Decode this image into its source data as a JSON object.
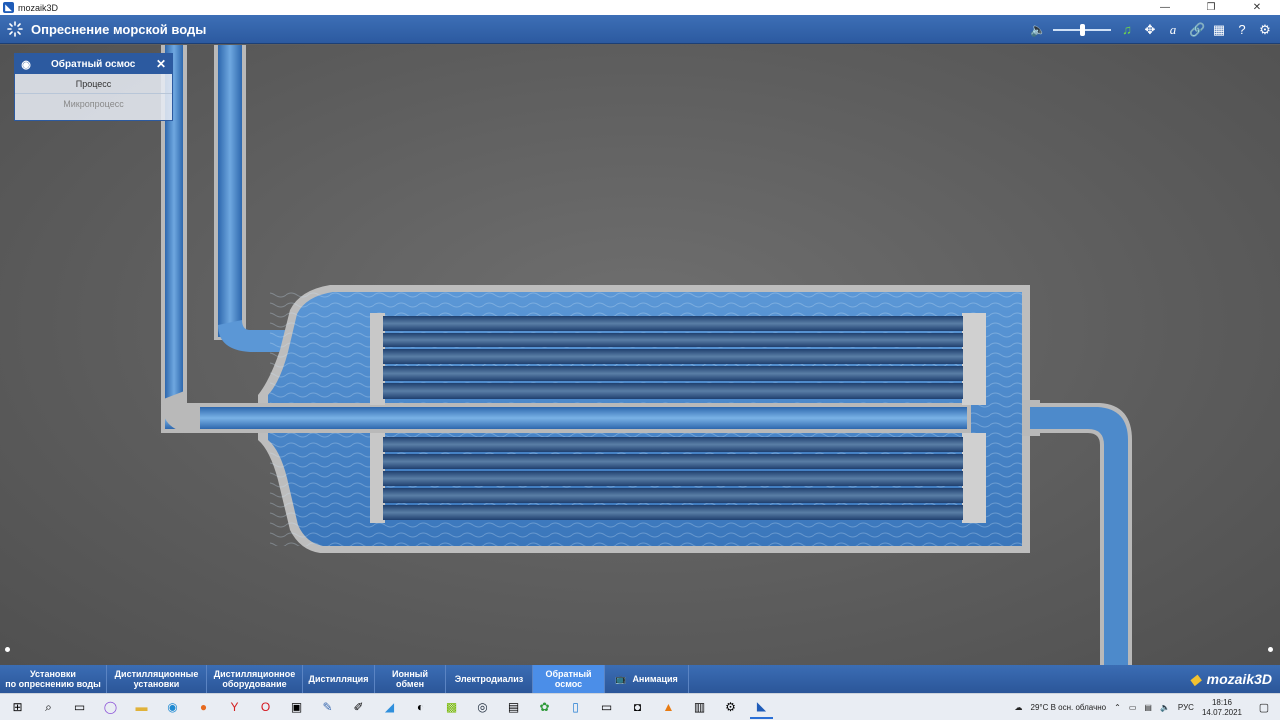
{
  "window": {
    "title": "mozaik3D",
    "controls": [
      "—",
      "❐",
      "✕"
    ]
  },
  "header": {
    "title": "Опреснение морской воды",
    "volume_level": 0.5,
    "tools": [
      "speaker-icon",
      "music-icon",
      "move-icon",
      "font-icon",
      "link-icon",
      "grid-icon",
      "help-icon",
      "gear-icon"
    ]
  },
  "panel": {
    "title": "Обратный осмос",
    "items": [
      "Процесс",
      "Микропроцесс"
    ]
  },
  "nav": {
    "tabs": [
      "Установки\nпо опреснению воды",
      "Дистилляционные\nустановки",
      "Дистилляционное\nоборудование",
      "Дистилляция",
      "Ионный\nобмен",
      "Электродиализ",
      "Обратный\nосмос",
      "Анимация"
    ],
    "active_index": 6,
    "brand": "mozaik3D"
  },
  "taskbar": {
    "weather": "29°C  В осн. облачно",
    "lang": "РУС",
    "time": "18:16",
    "date": "14.07.2021"
  },
  "colors": {
    "accent": "#2c5aa0",
    "active_tab": "#4b8ee8",
    "water": "#3f7fc6"
  }
}
